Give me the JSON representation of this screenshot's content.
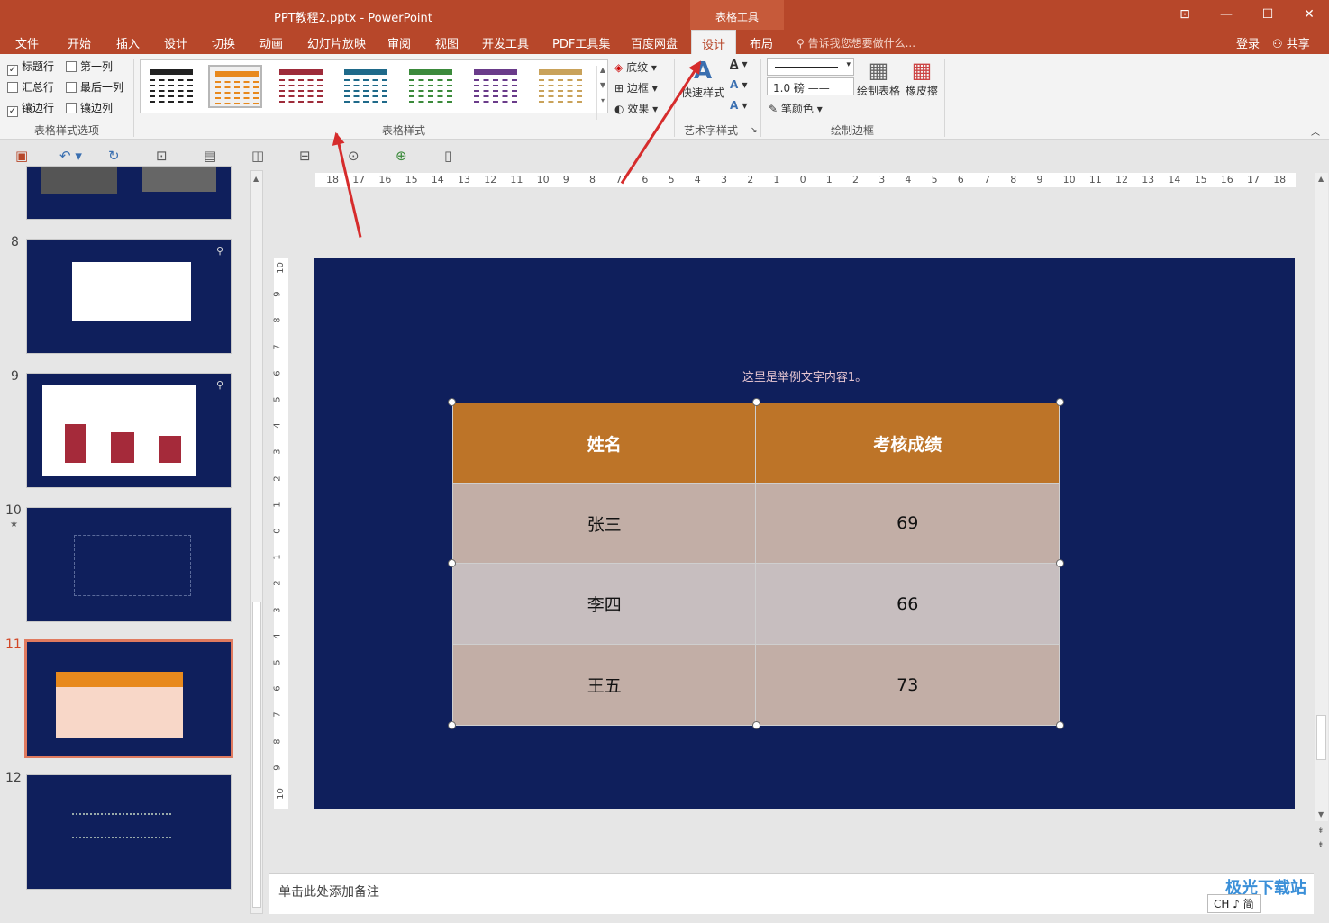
{
  "window": {
    "title": "PPT教程2.pptx - PowerPoint",
    "context_tab": "表格工具",
    "controls": [
      "⊡",
      "—",
      "☐",
      "✕"
    ]
  },
  "tabs": [
    {
      "label": "文件"
    },
    {
      "label": "开始"
    },
    {
      "label": "插入"
    },
    {
      "label": "设计"
    },
    {
      "label": "切换"
    },
    {
      "label": "动画"
    },
    {
      "label": "幻灯片放映"
    },
    {
      "label": "审阅"
    },
    {
      "label": "视图"
    },
    {
      "label": "开发工具"
    },
    {
      "label": "PDF工具集"
    },
    {
      "label": "百度网盘"
    },
    {
      "label": "设计"
    },
    {
      "label": "布局"
    }
  ],
  "tell_me": "告诉我您想要做什么...",
  "login": "登录",
  "share": "共享",
  "ribbon": {
    "style_options": {
      "items": [
        {
          "label": "标题行",
          "checked": "✓"
        },
        {
          "label": "第一列",
          "checked": ""
        },
        {
          "label": "汇总行",
          "checked": ""
        },
        {
          "label": "最后一列",
          "checked": ""
        },
        {
          "label": "镶边行",
          "checked": "✓"
        },
        {
          "label": "镶边列",
          "checked": ""
        }
      ],
      "label": "表格样式选项"
    },
    "table_styles": {
      "label": "表格样式",
      "swatches": [
        "#222222",
        "#e8891d",
        "#9e2b3a",
        "#1f6a8a",
        "#3b8a3b",
        "#6a3b8a",
        "#c9a25a"
      ],
      "shading": "底纹",
      "border": "边框",
      "effects": "效果"
    },
    "wordart": {
      "quick_styles": "快速样式",
      "label": "艺术字样式"
    },
    "draw_borders": {
      "weight": "1.0 磅",
      "pen_color": "笔颜色",
      "draw_table": "绘制表格",
      "eraser": "橡皮擦",
      "label": "绘制边框"
    }
  },
  "slides": [
    {
      "num": "8"
    },
    {
      "num": "9"
    },
    {
      "num": "10"
    },
    {
      "num": "11"
    },
    {
      "num": "12"
    }
  ],
  "ruler_h": [
    "18",
    "17",
    "16",
    "15",
    "14",
    "13",
    "12",
    "11",
    "10",
    "9",
    "8",
    "7",
    "6",
    "5",
    "4",
    "3",
    "2",
    "1",
    "0",
    "1",
    "2",
    "3",
    "4",
    "5",
    "6",
    "7",
    "8",
    "9",
    "10",
    "11",
    "12",
    "13",
    "14",
    "15",
    "16",
    "17",
    "18"
  ],
  "ruler_v": [
    "10",
    "9",
    "8",
    "7",
    "6",
    "5",
    "4",
    "3",
    "2",
    "1",
    "0",
    "1",
    "2",
    "3",
    "4",
    "5",
    "6",
    "7",
    "8",
    "9",
    "10"
  ],
  "slide": {
    "caption": "这里是举例文字内容1。",
    "table": {
      "headers": [
        "姓名",
        "考核成绩"
      ],
      "rows": [
        [
          "张三",
          "69"
        ],
        [
          "李四",
          "66"
        ],
        [
          "王五",
          "73"
        ]
      ]
    }
  },
  "notes_placeholder": "单击此处添加备注",
  "watermark": "极光下载站",
  "ime": "CH ♪ 简"
}
